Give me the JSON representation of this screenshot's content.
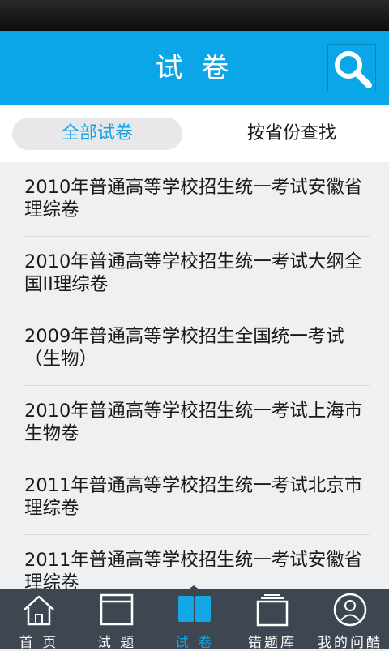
{
  "header": {
    "title": "试 卷"
  },
  "tabs": [
    {
      "label": "全部试卷"
    },
    {
      "label": "按省份查找"
    }
  ],
  "papers": [
    "2010年普通高等学校招生统一考试安徽省理综卷",
    "2010年普通高等学校招生统一考试大纲全国II理综卷",
    "2009年普通高等学校招生全国统一考试（生物）",
    "2010年普通高等学校招生统一考试上海市生物卷",
    "2011年普通高等学校招生统一考试北京市理综卷",
    "2011年普通高等学校招生统一考试安徽省理综卷"
  ],
  "tabbar": [
    {
      "label": "首 页",
      "icon": "home-icon"
    },
    {
      "label": "试 题",
      "icon": "questions-icon"
    },
    {
      "label": "试 卷",
      "icon": "open-book-icon",
      "active": true
    },
    {
      "label": "错题库",
      "icon": "stack-icon"
    },
    {
      "label": "我的问酷",
      "icon": "user-icon"
    }
  ],
  "colors": {
    "accent": "#0aa6e8",
    "tabbar_bg": "#3d4651",
    "active_text": "#1aa3e3"
  }
}
